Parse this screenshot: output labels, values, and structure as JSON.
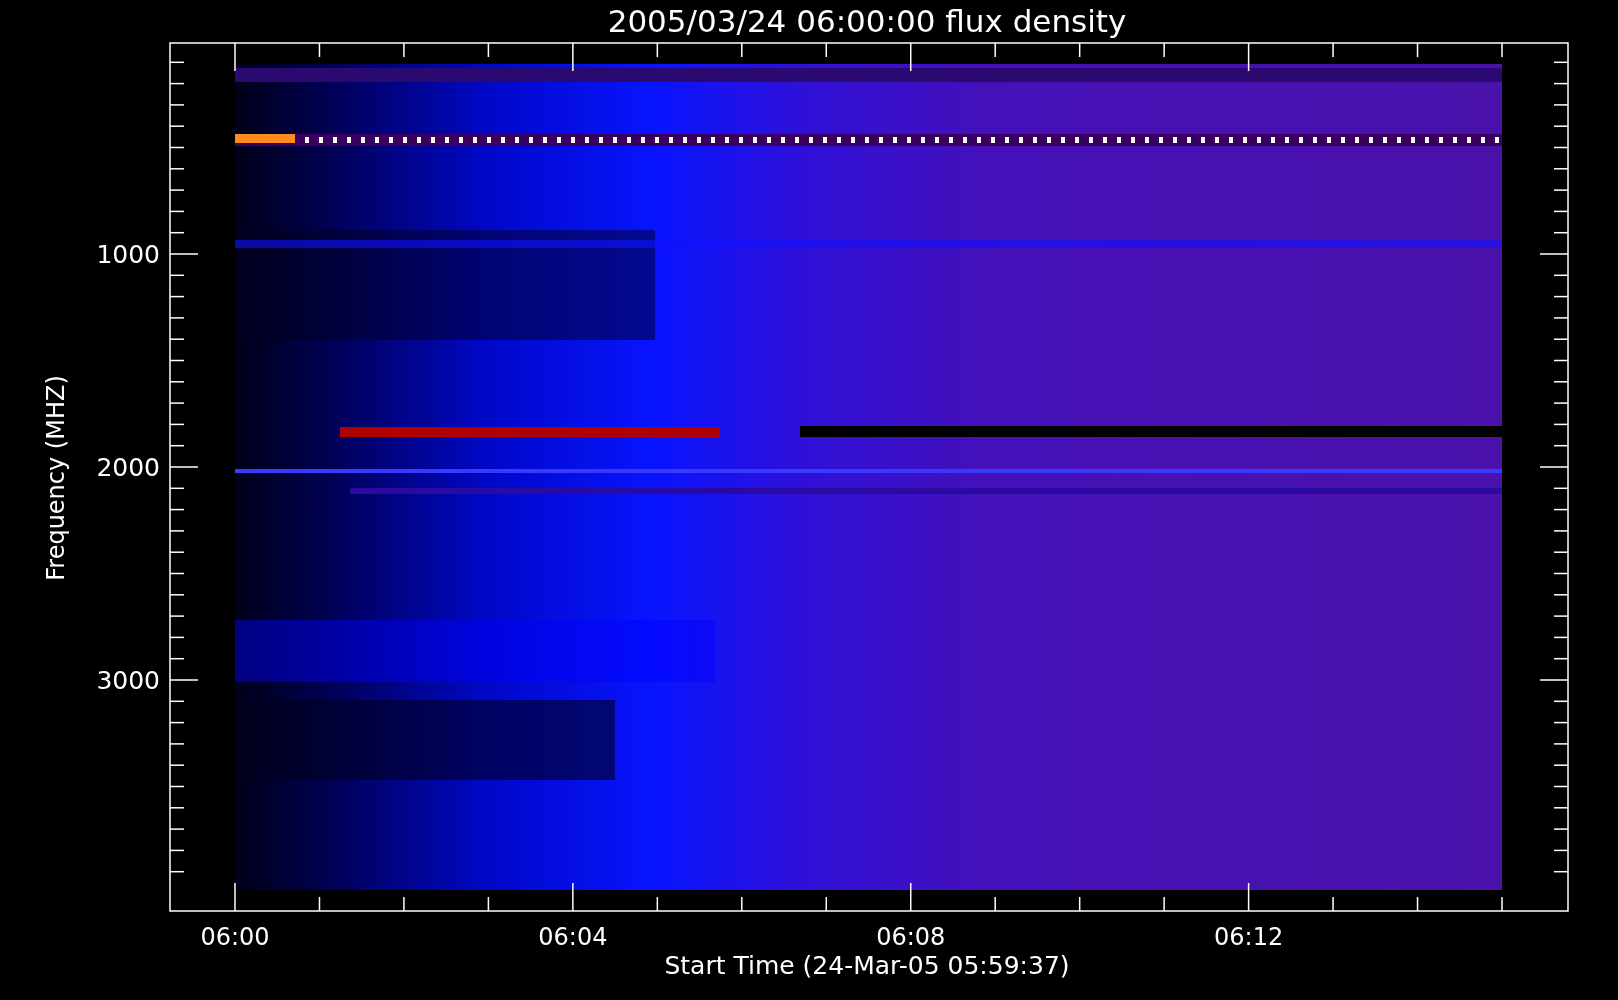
{
  "title": "2005/03/24 06:00:00 flux density",
  "ylabel": "Frequency (MHZ)",
  "xlabel": "Start Time (24-Mar-05 05:59:37)",
  "xticks": [
    "06:00",
    "06:04",
    "06:08",
    "06:12"
  ],
  "yticks": [
    "1000",
    "2000",
    "3000"
  ]
}
